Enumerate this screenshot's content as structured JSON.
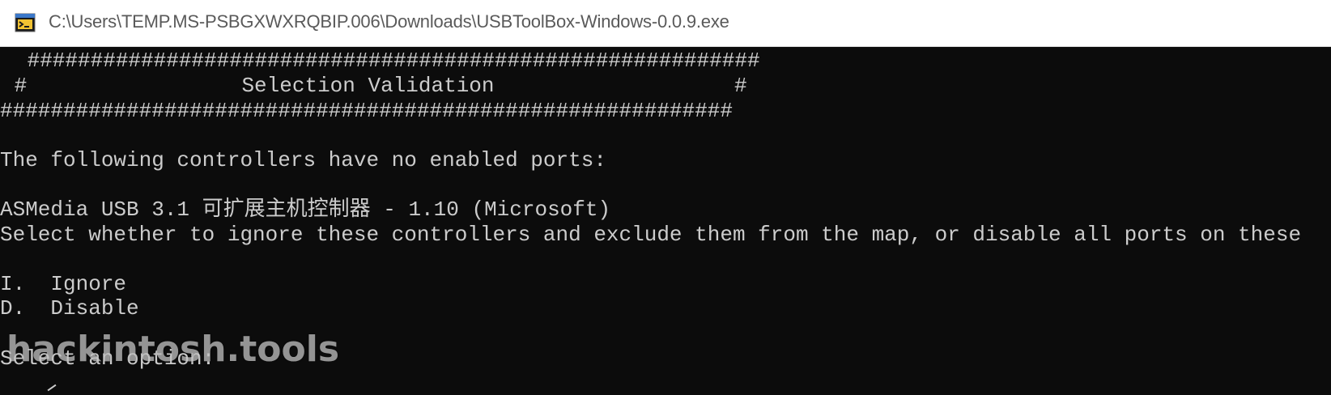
{
  "window": {
    "title": "C:\\Users\\TEMP.MS-PSBGXWXRQBIP.006\\Downloads\\USBToolBox-Windows-0.0.9.exe",
    "app_icon": "console-app-icon"
  },
  "console": {
    "lines": [
      " ##########################################################",
      " #                 Selection Validation                   #",
      "##########################################################",
      "",
      "The following controllers have no enabled ports:",
      "",
      "ASMedia USB 3.1 可扩展主机控制器 - 1.10 (Microsoft)",
      "Select whether to ignore these controllers and exclude them from the map, or disable all ports on these",
      "",
      "I.  Ignore",
      "D.  Disable",
      "",
      "Select an option:"
    ]
  },
  "watermark": "hackintosh.tools",
  "colors": {
    "console_bg": "#0c0c0c",
    "console_fg": "#cccccc",
    "titlebar_bg": "#ffffff",
    "title_fg": "#5a5a5a"
  }
}
